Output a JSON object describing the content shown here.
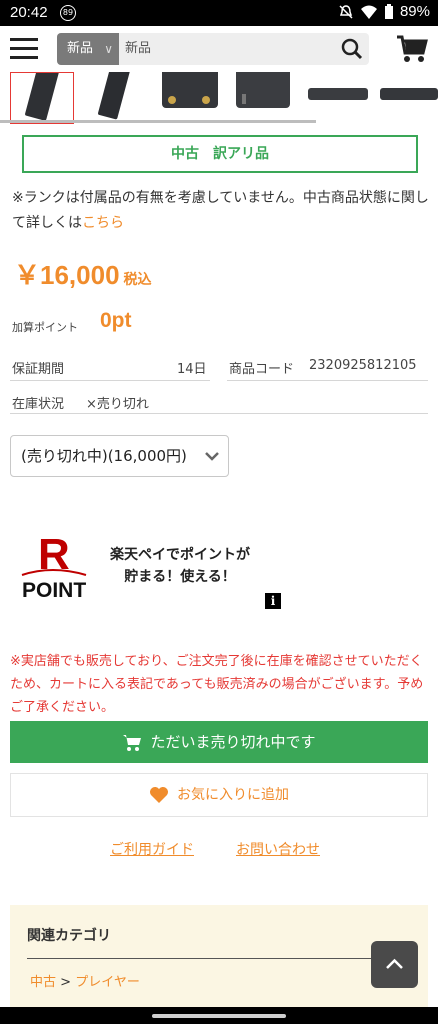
{
  "status_bar": {
    "time": "20:42",
    "badge": "89",
    "battery": "89%"
  },
  "header": {
    "search_category": "新品",
    "search_value": "新品"
  },
  "product": {
    "rank_label": "中古　訳アリ品",
    "note_text": "※ランクは付属品の有無を考慮していません。中古商品状態に関して詳しくは",
    "note_link": "こちら",
    "price": "￥16,000",
    "tax_label": "税込",
    "points_label": "加算ポイント",
    "points_value": "0pt",
    "warranty_label": "保証期間",
    "warranty_value": "14日",
    "code_label": "商品コード",
    "code_value": "2320925812105",
    "stock_label": "在庫状況",
    "stock_value": "×売り切れ",
    "option_selected": "(売り切れ中)(16,000円)"
  },
  "rakuten": {
    "logo_letter": "R",
    "logo_word": "POINT",
    "line1": "楽天ペイでポイントが",
    "line2": "貯まる！使える！",
    "info_icon": "i"
  },
  "warning_text": "※実店舗でも販売しており、ご注文完了後に在庫を確認させていただくため、カートに入る表記であっても販売済みの場合がございます。予めご了承ください。",
  "buttons": {
    "soldout_label": "ただいま売り切れ中です",
    "favorite_label": "お気に入りに追加"
  },
  "links": {
    "guide": "ご利用ガイド",
    "contact": "お問い合わせ"
  },
  "related": {
    "title": "関連カテゴリ",
    "crumb_root": "中古",
    "crumb_sep": ">",
    "crumb_child": "プレイヤー"
  },
  "colors": {
    "accent_orange": "#f08c2c",
    "accent_green": "#3aa757",
    "warning_red": "#e53935"
  }
}
